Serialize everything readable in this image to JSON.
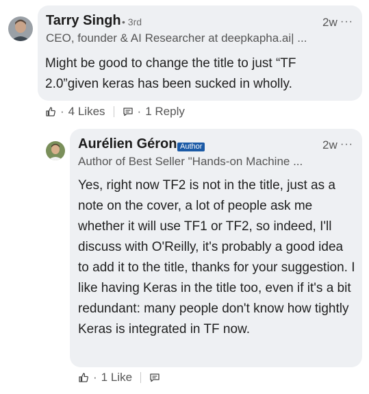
{
  "comment": {
    "author_name": "Tarry Singh",
    "degree": "• 3rd",
    "headline": "CEO, founder & AI Researcher at deepkapha.ai| ...",
    "time": "2w",
    "more": "···",
    "text": "Might be good to change the title to just “TF 2.0”given keras has been sucked in wholly.",
    "likes_label": "4 Likes",
    "replies_label": "1 Reply",
    "dot": "·"
  },
  "reply": {
    "author_name": "Aurélien Géron",
    "badge": "Author",
    "headline": "Author of Best Seller \"Hands-on Machine ...",
    "time": "2w",
    "more": "···",
    "text": "Yes, right now TF2 is not in the title, just as a note on the cover, a lot of people ask me whether it will use TF1 or TF2, so indeed, I'll discuss with O'Reilly, it's probably a good idea to add it to the title, thanks for your suggestion. I like having Keras in the title too, even if it's a bit redundant: many people don't know how tightly Keras is integrated in TF now.",
    "likes_label": "1 Like",
    "dot": "·"
  },
  "icons": {
    "like": "thumbs-up-icon",
    "reply": "comment-icon"
  }
}
